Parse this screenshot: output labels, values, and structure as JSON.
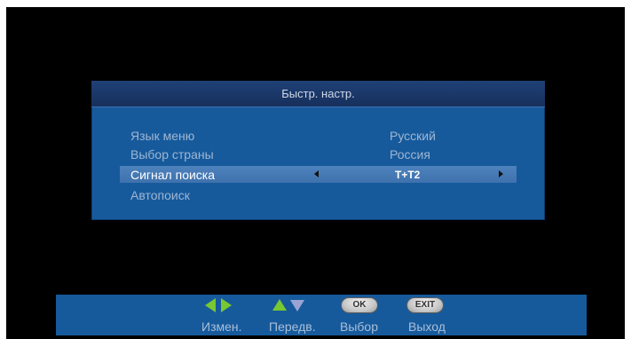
{
  "menu": {
    "title": "Быстр. настр.",
    "rows": [
      {
        "label": "Язык меню",
        "value": "Русский"
      },
      {
        "label": "Выбор страны",
        "value": "Россия"
      },
      {
        "label": "Сигнал поиска",
        "value": "T+T2"
      },
      {
        "label": "Автопоиск",
        "value": ""
      }
    ],
    "selected_index": 2
  },
  "helpbar": {
    "items": [
      {
        "key": "left-right",
        "label": "Измен."
      },
      {
        "key": "up-down",
        "label": "Передв."
      },
      {
        "key": "ok",
        "key_label": "OK",
        "label": "Выбор"
      },
      {
        "key": "exit",
        "key_label": "EXIT",
        "label": "Выход"
      }
    ]
  },
  "colors": {
    "panel": "#165a9c",
    "header": "#1f4177",
    "highlight": "#4e82bd",
    "green_arrow": "#78c832"
  },
  "icons": [
    "left-arrow-icon",
    "right-arrow-icon",
    "up-arrow-icon",
    "down-arrow-icon",
    "ok-key-icon",
    "exit-key-icon"
  ]
}
